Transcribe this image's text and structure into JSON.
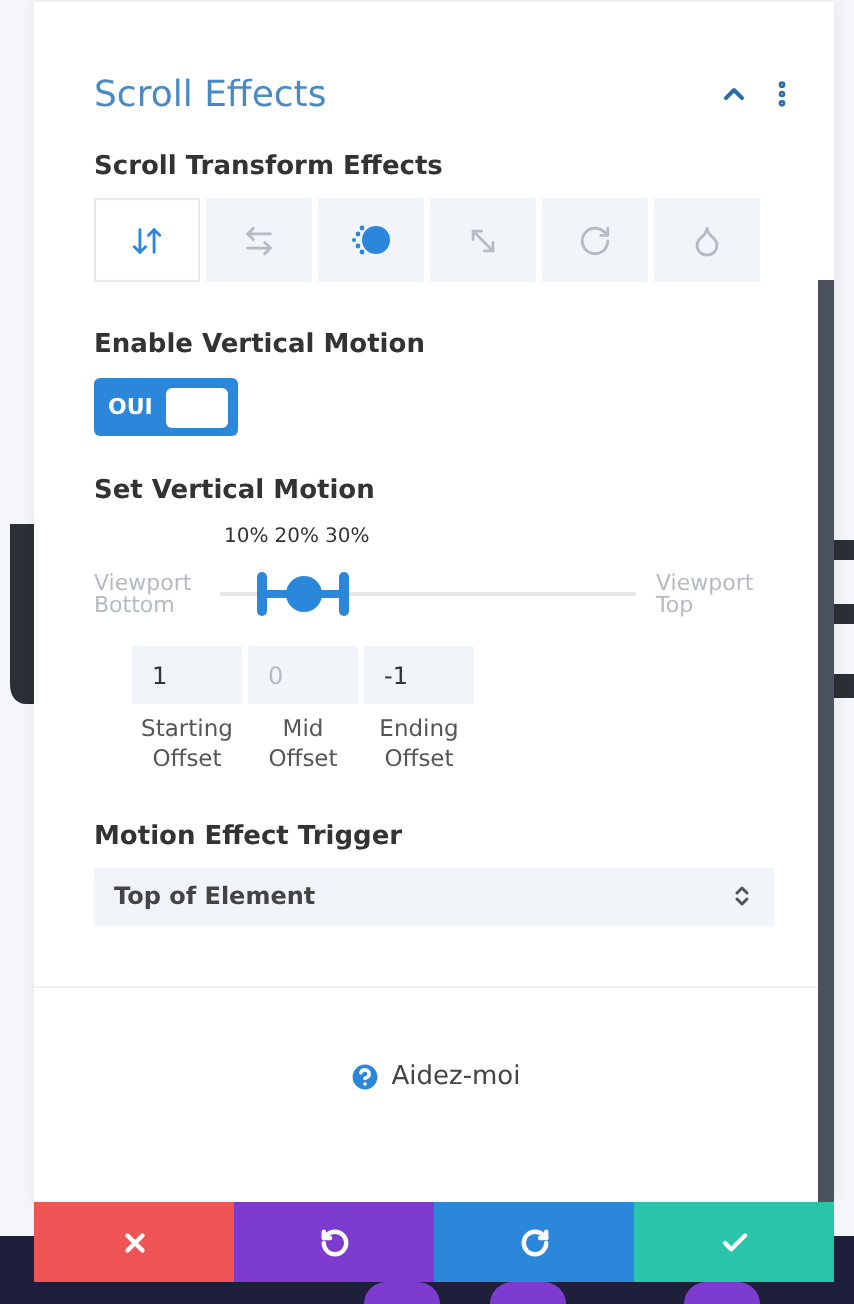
{
  "panel": {
    "title": "Scroll Effects",
    "expanded": true
  },
  "effects": {
    "label": "Scroll Transform Effects",
    "tabs": [
      {
        "kind": "vertical",
        "selected": true,
        "active": true
      },
      {
        "kind": "horizontal",
        "selected": false,
        "active": false
      },
      {
        "kind": "blur",
        "selected": false,
        "active": true
      },
      {
        "kind": "scale",
        "selected": false,
        "active": false
      },
      {
        "kind": "rotate",
        "selected": false,
        "active": false
      },
      {
        "kind": "opacity",
        "selected": false,
        "active": false
      }
    ]
  },
  "enable": {
    "label": "Enable Vertical Motion",
    "toggle_text": "OUI",
    "on": true
  },
  "motion": {
    "label": "Set Vertical Motion",
    "start_label": "Viewport Bottom",
    "end_label": "Viewport Top",
    "handles": [
      {
        "reading": "10%",
        "level": 0.1
      },
      {
        "reading": "20%",
        "level": 0.2
      },
      {
        "reading": "30%",
        "level": 0.3
      }
    ],
    "offsets": [
      {
        "value": "1",
        "label": "Starting Offset"
      },
      {
        "placeholder": "0",
        "label": "Mid Offset"
      },
      {
        "value": "-1",
        "label": "Ending Offset"
      }
    ]
  },
  "trigger": {
    "label": "Motion Effect Trigger",
    "value": "Top of Element"
  },
  "help": {
    "label": "Aidez-moi"
  },
  "actions": [
    {
      "kind": "cancel"
    },
    {
      "kind": "undo"
    },
    {
      "kind": "redo"
    },
    {
      "kind": "save"
    }
  ]
}
